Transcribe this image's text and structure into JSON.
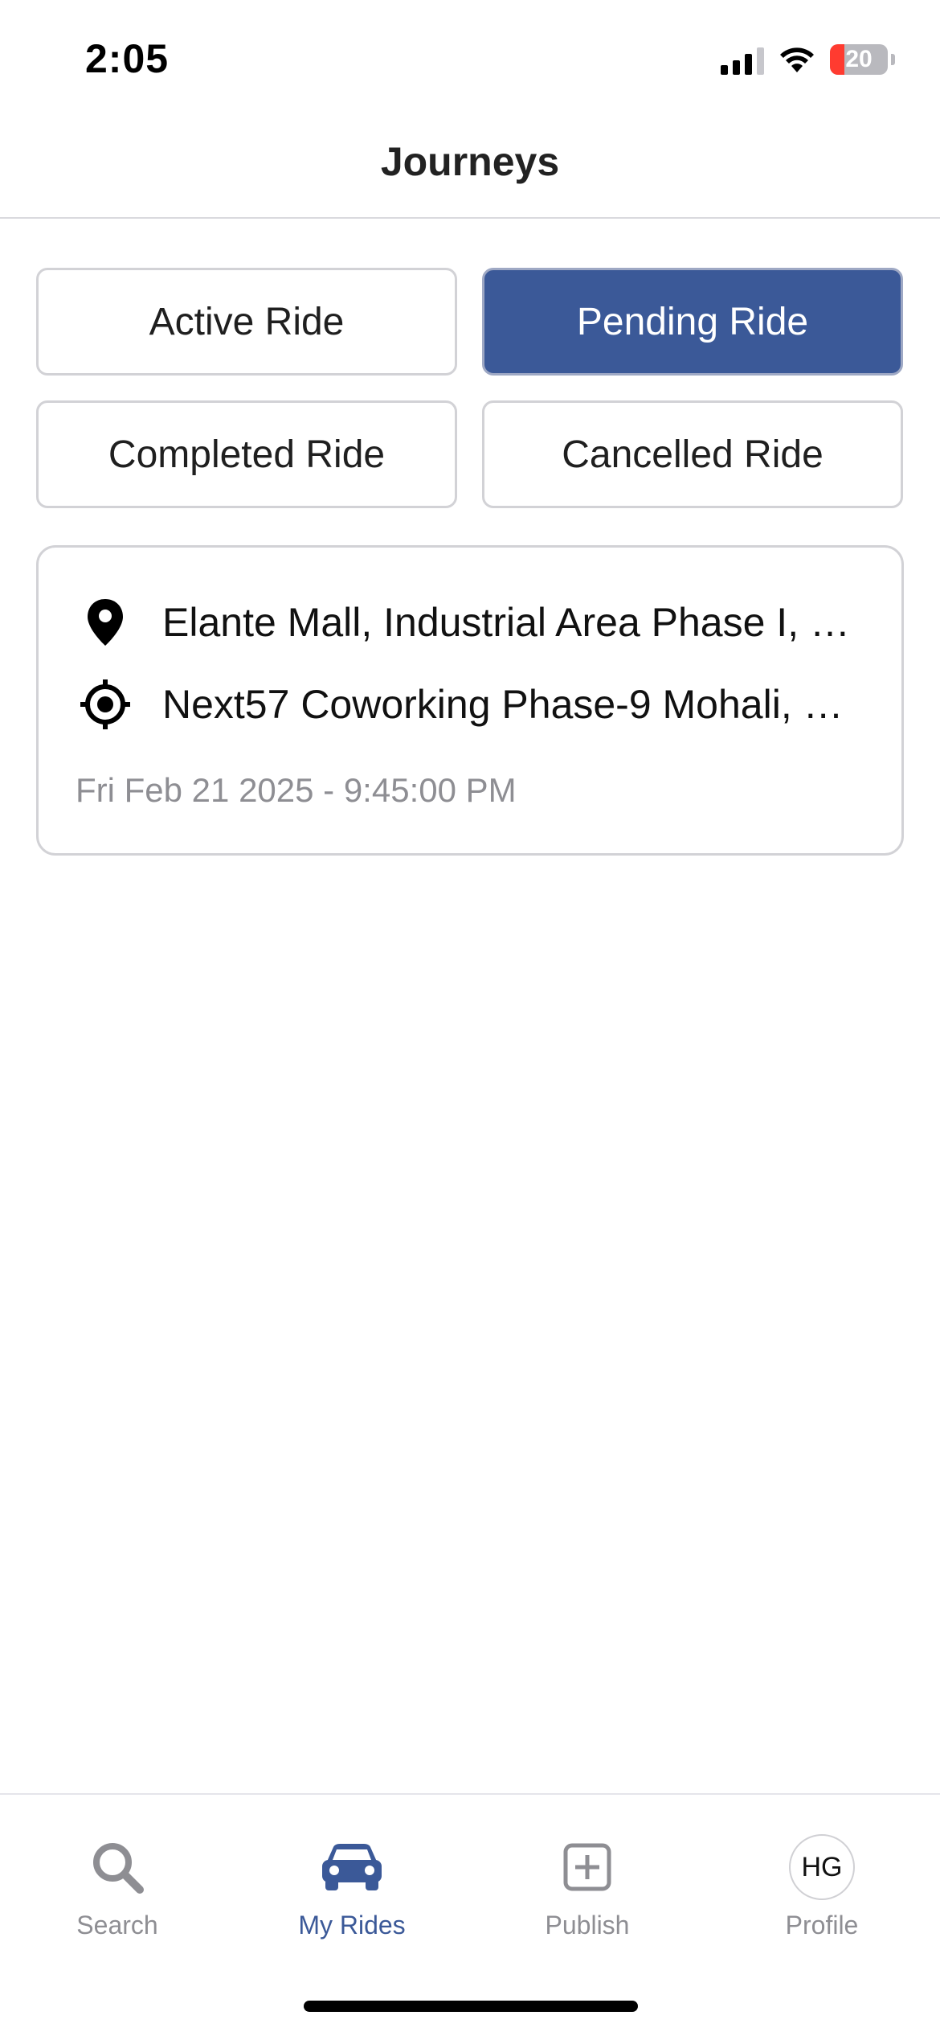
{
  "status_bar": {
    "time": "2:05",
    "battery_level": "20"
  },
  "header": {
    "title": "Journeys"
  },
  "filters": [
    {
      "label": "Active Ride",
      "selected": false
    },
    {
      "label": "Pending Ride",
      "selected": true
    },
    {
      "label": "Completed Ride",
      "selected": false
    },
    {
      "label": "Cancelled Ride",
      "selected": false
    }
  ],
  "rides": [
    {
      "pickup": "Elante Mall, Industrial Area Phase I, C...",
      "pickup_icon": "map-pin-icon",
      "dropoff": "Next57 Coworking Phase-9 Mohali, n...",
      "dropoff_icon": "crosshair-target-icon",
      "datetime": "Fri Feb 21 2025 - 9:45:00 PM"
    }
  ],
  "tab_bar": {
    "tabs": [
      {
        "label": "Search",
        "icon": "search-icon",
        "selected": false
      },
      {
        "label": "My Rides",
        "icon": "car-icon",
        "selected": true
      },
      {
        "label": "Publish",
        "icon": "plus-square-icon",
        "selected": false
      },
      {
        "label": "Profile",
        "icon": "avatar-icon",
        "avatar_initials": "HG",
        "selected": false
      }
    ]
  },
  "colors": {
    "accent": "#3b5998",
    "border": "#d2d2d6",
    "muted_text": "#8e8e93",
    "battery_low": "#ff3b30"
  }
}
